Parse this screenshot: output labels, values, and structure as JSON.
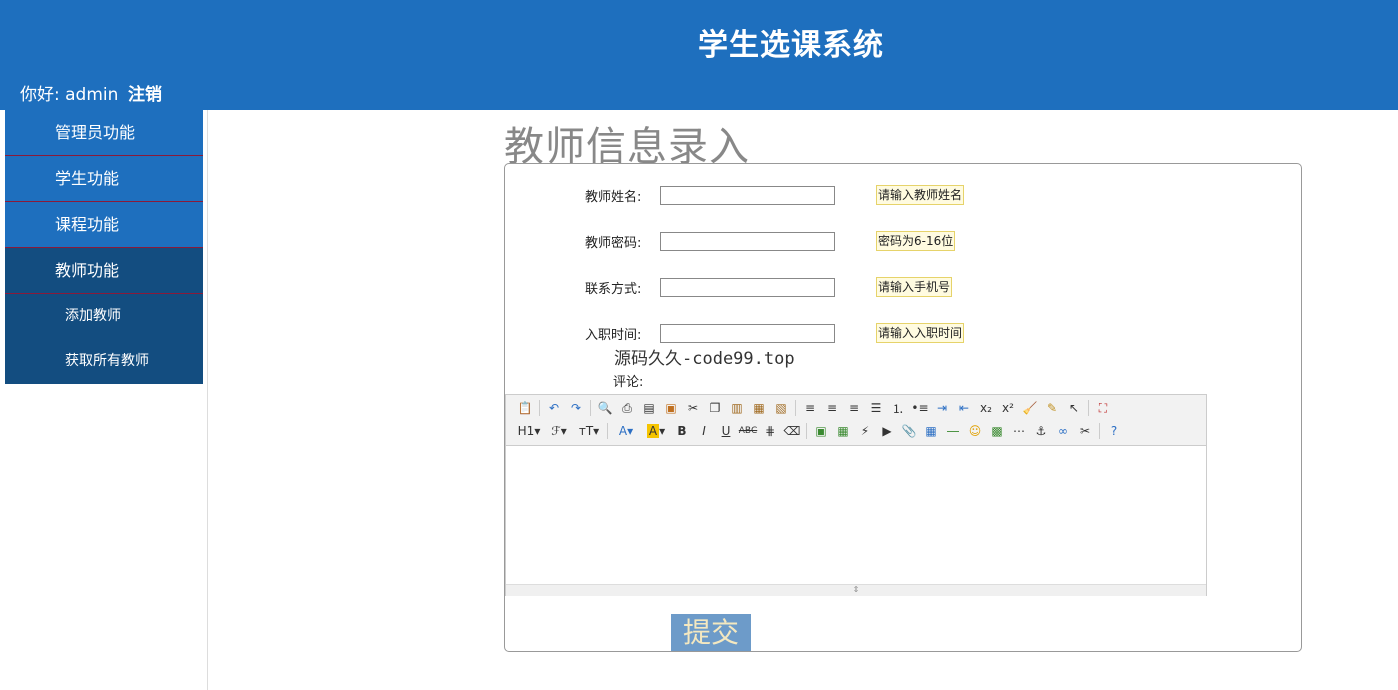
{
  "header": {
    "title": "学生选课系统",
    "greeting": "你好: admin",
    "logout": "注销"
  },
  "sidebar": {
    "items": [
      {
        "label": "管理员功能"
      },
      {
        "label": "学生功能"
      },
      {
        "label": "课程功能"
      },
      {
        "label": "教师功能"
      }
    ],
    "subitems": [
      {
        "label": "添加教师"
      },
      {
        "label": "获取所有教师"
      }
    ]
  },
  "page": {
    "title": "教师信息录入",
    "watermark": "源码久久-code99.top",
    "comment_label": "评论:",
    "submit": "提交"
  },
  "form": {
    "fields": [
      {
        "label": "教师姓名:",
        "value": "",
        "hint": "请输入教师姓名"
      },
      {
        "label": "教师密码:",
        "value": "",
        "hint": "密码为6-16位"
      },
      {
        "label": "联系方式:",
        "value": "",
        "hint": "请输入手机号"
      },
      {
        "label": "入职时间:",
        "value": "",
        "hint": "请输入入职时间"
      }
    ]
  },
  "editor": {
    "toolbar_row1": [
      "source-icon",
      "undo-icon",
      "redo-icon",
      "preview-icon",
      "print-icon",
      "template-icon",
      "code-icon",
      "cut-icon",
      "copy-icon",
      "paste-icon",
      "paste-text-icon",
      "paste-word-icon",
      "align-left-icon",
      "align-center-icon",
      "align-right-icon",
      "justify-icon",
      "ordered-list-icon",
      "unordered-list-icon",
      "indent-icon",
      "outdent-icon",
      "subscript-icon",
      "superscript-icon",
      "clear-format-icon",
      "select-all-icon",
      "cursor-icon",
      "fullscreen-icon"
    ],
    "toolbar_row2": [
      "heading-icon",
      "font-family-icon",
      "font-size-icon",
      "font-color-icon",
      "highlight-icon",
      "bold-icon",
      "italic-icon",
      "underline-icon",
      "strikethrough-icon",
      "line-height-icon",
      "eraser-icon",
      "image-icon",
      "multi-image-icon",
      "flash-icon",
      "media-icon",
      "attachment-icon",
      "table-icon",
      "horizontal-rule-icon",
      "emoticon-icon",
      "map-icon",
      "page-break-icon",
      "anchor-icon",
      "link-icon",
      "unlink-icon",
      "help-icon"
    ]
  },
  "colors": {
    "header_bg": "#1e6fbe",
    "sidebar_active": "#134d80",
    "hint_bg": "#fffbe0",
    "submit_bg": "#6d9bc9"
  }
}
